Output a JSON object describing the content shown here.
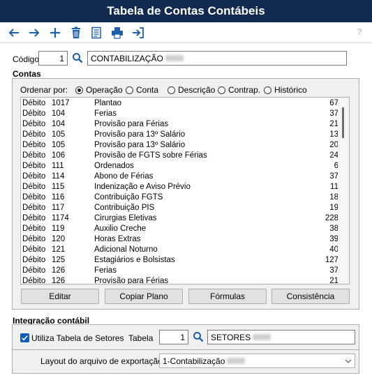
{
  "window": {
    "title": "Tabela de Contas Contábeis"
  },
  "toolbar": {
    "icons": [
      "arrow-left-icon",
      "arrow-right-icon",
      "plus-icon",
      "trash-icon",
      "document-icon",
      "printer-icon",
      "exit-icon"
    ],
    "help": "?"
  },
  "header": {
    "codigo_label": "Código",
    "codigo_value": "1",
    "description_value": "CONTABILIZAÇÃO"
  },
  "contas": {
    "title": "Contas",
    "order_label": "Ordenar por:",
    "order_options": [
      "Operação",
      "Conta",
      "Descrição",
      "Contrap.",
      "Histórico"
    ],
    "selected_option": "Operação",
    "rows": [
      [
        "Débito",
        "1017",
        "Plantao",
        "67"
      ],
      [
        "Débito",
        "104",
        "Ferias",
        "37"
      ],
      [
        "Débito",
        "104",
        "Provisão para Férias",
        "21"
      ],
      [
        "Débito",
        "105",
        "Provisão para 13º Salário",
        "13"
      ],
      [
        "Débito",
        "105",
        "Provisão para 13º Salário",
        "20"
      ],
      [
        "Débito",
        "106",
        "Provisão de FGTS sobre Férias",
        "24"
      ],
      [
        "Débito",
        "111",
        "Ordenados",
        "6"
      ],
      [
        "Débito",
        "114",
        "Abono de Férias",
        "37"
      ],
      [
        "Débito",
        "115",
        "Indenização e Aviso Prévio",
        "11"
      ],
      [
        "Débito",
        "116",
        "Contribuição FGTS",
        "18"
      ],
      [
        "Débito",
        "117",
        "Contribuição PIS",
        "19"
      ],
      [
        "Débito",
        "1174",
        "Cirurgias Eletivas",
        "228"
      ],
      [
        "Débito",
        "119",
        "Auxilio Creche",
        "38"
      ],
      [
        "Débito",
        "120",
        "Horas Extras",
        "39"
      ],
      [
        "Débito",
        "121",
        "Adicional Noturno",
        "40"
      ],
      [
        "Débito",
        "125",
        "Estagiários e Bolsistas",
        "127"
      ],
      [
        "Débito",
        "126",
        "Ferias",
        "37"
      ],
      [
        "Débito",
        "126",
        "Provisão para Férias",
        "21"
      ]
    ],
    "buttons": {
      "editar": "Editar",
      "copiar": "Copiar Plano",
      "formulas": "Fórmulas",
      "consistencia": "Consistência"
    }
  },
  "integracao": {
    "title": "Integração contábil",
    "utiliza_label": "Utiliza Tabela de Setores",
    "utiliza_checked": true,
    "tabela_label": "Tabela",
    "tabela_value": "1",
    "tabela_desc": "SETORES",
    "layout_label": "Layout do arquivo de exportação",
    "layout_value": "1-Contabilização"
  },
  "colors": {
    "title_bg": "#122a4f",
    "accent": "#0d5fbf",
    "icon_blue": "#1d5fa8"
  }
}
